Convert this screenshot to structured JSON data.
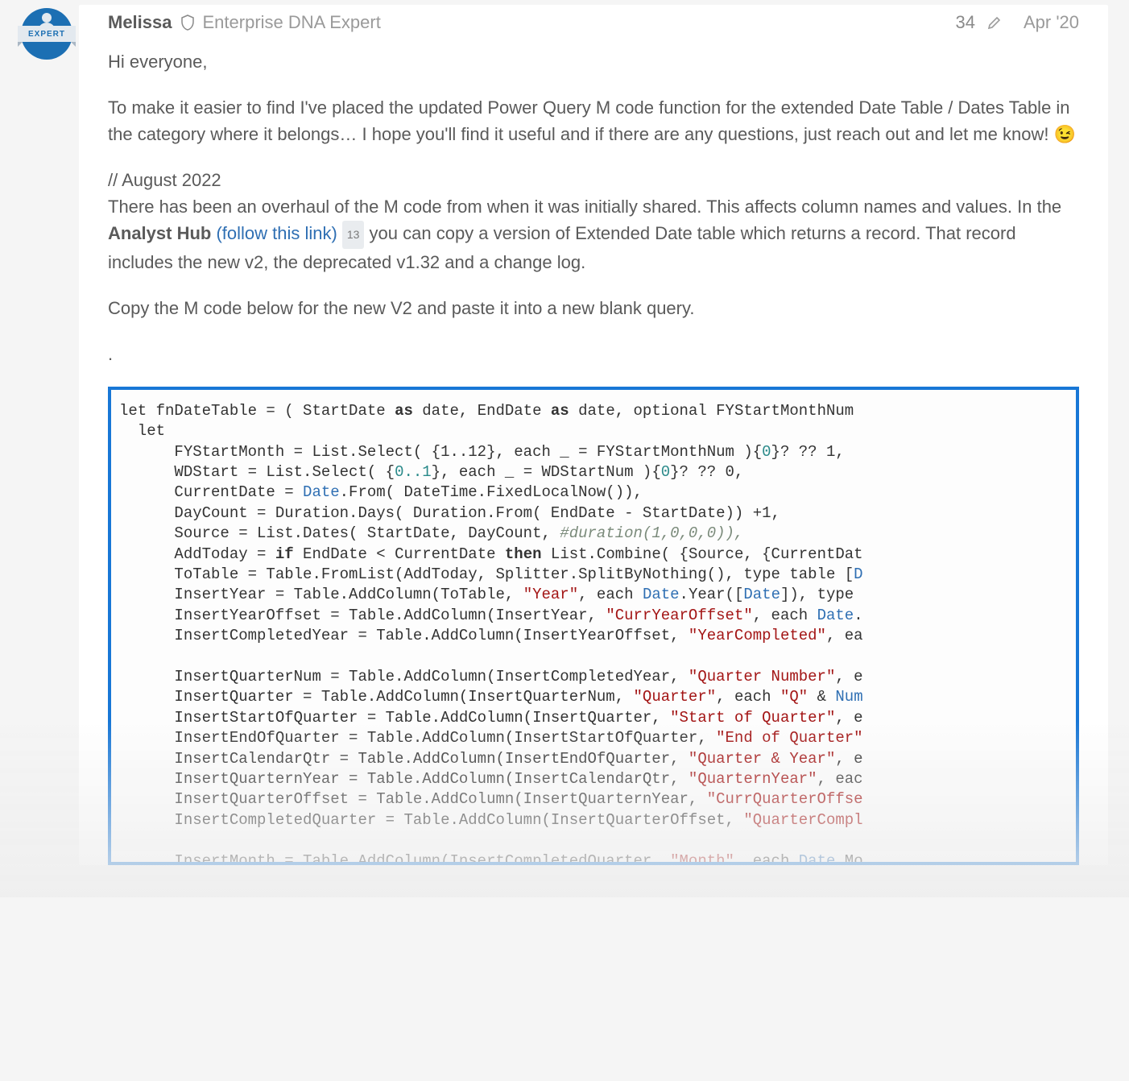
{
  "avatar": {
    "ribbon": "EXPERT"
  },
  "header": {
    "username": "Melissa",
    "role": "Enterprise DNA Expert",
    "edit_count": "34",
    "date": "Apr '20"
  },
  "body": {
    "greeting": "Hi everyone,",
    "p1": "To make it easier to find I've placed the updated Power Query M code function for the extended Date Table / Dates Table in the category where it belongs… I hope you'll find it useful and if there are any questions, just reach out and let me know! 😉",
    "update_label": "// August 2022",
    "p2a": "There has been an overhaul of the M code from when it was initially shared. This affects column names and values. In the ",
    "p2_strong": "Analyst Hub",
    "p2_link": "(follow this link)",
    "p2_badge": "13",
    "p2b": " you can copy a version of Extended Date table which returns a record. That record includes the new v2, the deprecated v1.32 and a change log.",
    "p3": "Copy the M code below for the new V2 and paste it into a new blank query.",
    "dot": "."
  },
  "code": {
    "l1a": "let fnDateTable = ( StartDate ",
    "kw1": "as",
    "l1b": " date, EndDate ",
    "kw2": "as",
    "l1c": " date, optional FYStartMonthNum",
    "l2": "  let",
    "l3a": "      FYStartMonth = List.Select( {1..12}, each _ = FYStartMonthNum ){",
    "n3": "0",
    "l3b": "}? ?? 1,",
    "l4a": "      WDStart = List.Select( {",
    "n4a": "0..1",
    "l4b": "}, each _ = WDStartNum ){",
    "n4b": "0",
    "l4c": "}? ?? 0,",
    "l5a": "      CurrentDate = ",
    "id5": "Date",
    "l5b": ".From( DateTime.FixedLocalNow()),",
    "l6": "      DayCount = Duration.Days( Duration.From( EndDate - StartDate)) +1,",
    "l7a": "      Source = List.Dates( StartDate, DayCount, ",
    "cm7": "#duration(1,0,0,0)),",
    "l8a": "      AddToday = ",
    "kw8a": "if",
    "l8b": " EndDate < CurrentDate ",
    "kw8b": "then",
    "l8c": " List.Combine( {Source, {CurrentDat",
    "l9a": "      ToTable = Table.FromList(AddToday, Splitter.SplitByNothing(), type table [",
    "id9": "D",
    "l10a": "      InsertYear = Table.AddColumn(ToTable, ",
    "s10": "\"Year\"",
    "l10b": ", each ",
    "id10a": "Date",
    "l10c": ".Year([",
    "id10b": "Date",
    "l10d": "]), type",
    "l11a": "      InsertYearOffset = Table.AddColumn(InsertYear, ",
    "s11": "\"CurrYearOffset\"",
    "l11b": ", each ",
    "id11": "Date",
    "l11c": ".",
    "l12a": "      InsertCompletedYear = Table.AddColumn(InsertYearOffset, ",
    "s12": "\"YearCompleted\"",
    "l12b": ", ea",
    "blank1": "",
    "l13a": "      InsertQuarterNum = Table.AddColumn(InsertCompletedYear, ",
    "s13": "\"Quarter Number\"",
    "l13b": ", e",
    "l14a": "      InsertQuarter = Table.AddColumn(InsertQuarterNum, ",
    "s14a": "\"Quarter\"",
    "l14b": ", each ",
    "s14b": "\"Q\"",
    "l14c": " & ",
    "id14": "Num",
    "l15a": "      InsertStartOfQuarter = Table.AddColumn(InsertQuarter, ",
    "s15": "\"Start of Quarter\"",
    "l15b": ", e",
    "l16a": "      InsertEndOfQuarter = Table.AddColumn(InsertStartOfQuarter, ",
    "s16": "\"End of Quarter\"",
    "l17a": "      InsertCalendarQtr = Table.AddColumn(InsertEndOfQuarter, ",
    "s17": "\"Quarter & Year\"",
    "l17b": ", e",
    "l18a": "      InsertQuarternYear = Table.AddColumn(InsertCalendarQtr, ",
    "s18": "\"QuarternYear\"",
    "l18b": ", eac",
    "l19a": "      InsertQuarterOffset = Table.AddColumn(InsertQuarternYear, ",
    "s19": "\"CurrQuarterOffse",
    "l20a": "      InsertCompletedQuarter = Table.AddColumn(InsertQuarterOffset, ",
    "s20": "\"QuarterCompl",
    "blank2": "",
    "l21a": "      InsertMonth = Table.AddColumn(InsertCompletedQuarter, ",
    "s21": "\"Month\"",
    "l21b": ", each ",
    "id21": "Date",
    "l21c": ".Mo"
  }
}
